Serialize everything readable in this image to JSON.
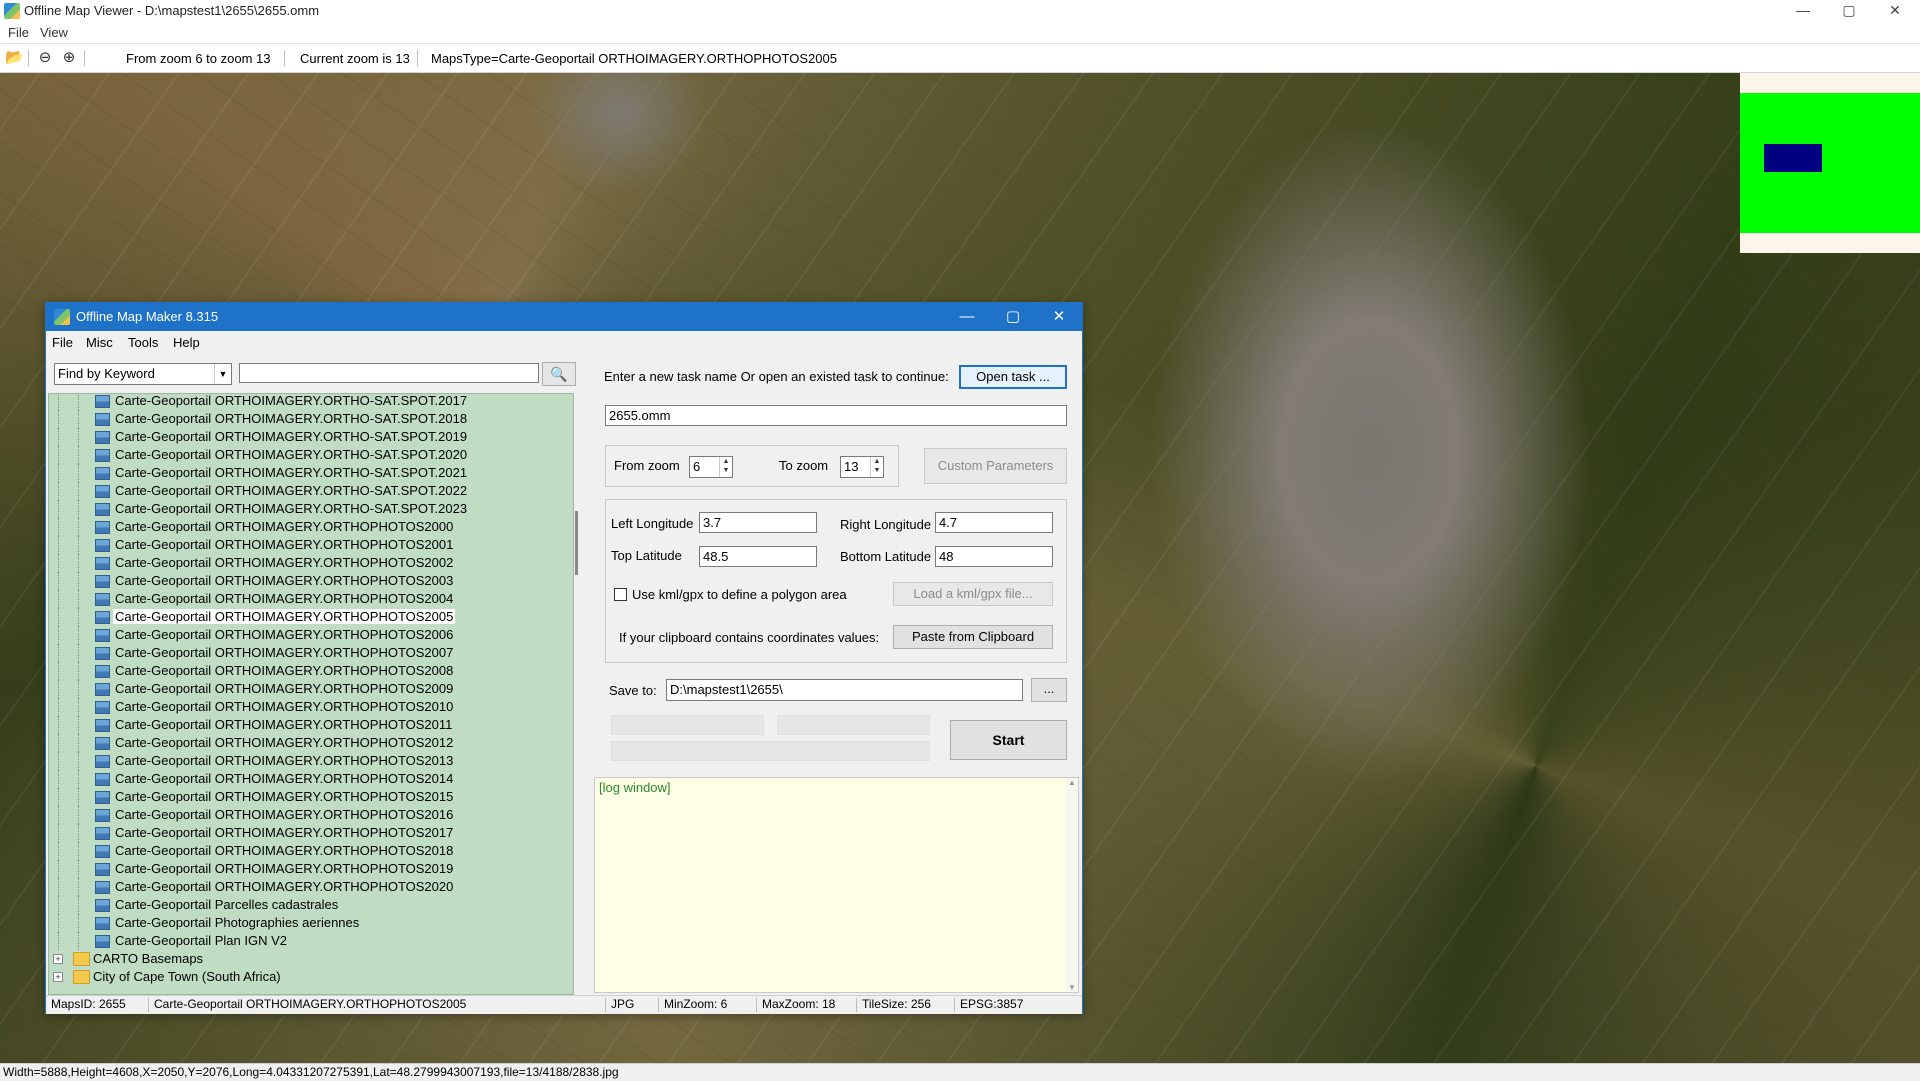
{
  "window": {
    "title": "Offline Map Viewer - D:\\mapstest1\\2655\\2655.omm",
    "menu": [
      "File",
      "View"
    ],
    "controls": [
      "—",
      "▢",
      "✕"
    ]
  },
  "toolbar": {
    "zoom_range": "From zoom 6 to zoom 13",
    "current_zoom": "Current zoom is 13",
    "maps_type": "MapsType=Carte-Geoportail ORTHOIMAGERY.ORTHOPHOTOS2005",
    "icons": [
      "open-folder-icon",
      "zoom-out-icon",
      "zoom-in-icon"
    ]
  },
  "statusbar": {
    "text": "Width=5888,Height=4608,X=2050,Y=2076,Long=4.04331207275391,Lat=48.2799943007193,file=13/4188/2838.jpg"
  },
  "colors": {
    "accent": "#1e73c8",
    "tree_bg": "#c0ddc4",
    "log_bg": "#ffffe6",
    "minimap_green": "#00ff00",
    "minimap_box": "#000080"
  },
  "dialog": {
    "title": "Offline Map Maker 8.315",
    "menu": [
      "File",
      "Misc",
      "Tools",
      "Help"
    ],
    "find_mode": "Find by Keyword",
    "search_value": "",
    "tree": {
      "selected_index": 12,
      "items": [
        "Carte-Geoportail ORTHOIMAGERY.ORTHO-SAT.SPOT.2017",
        "Carte-Geoportail ORTHOIMAGERY.ORTHO-SAT.SPOT.2018",
        "Carte-Geoportail ORTHOIMAGERY.ORTHO-SAT.SPOT.2019",
        "Carte-Geoportail ORTHOIMAGERY.ORTHO-SAT.SPOT.2020",
        "Carte-Geoportail ORTHOIMAGERY.ORTHO-SAT.SPOT.2021",
        "Carte-Geoportail ORTHOIMAGERY.ORTHO-SAT.SPOT.2022",
        "Carte-Geoportail ORTHOIMAGERY.ORTHO-SAT.SPOT.2023",
        "Carte-Geoportail ORTHOIMAGERY.ORTHOPHOTOS2000",
        "Carte-Geoportail ORTHOIMAGERY.ORTHOPHOTOS2001",
        "Carte-Geoportail ORTHOIMAGERY.ORTHOPHOTOS2002",
        "Carte-Geoportail ORTHOIMAGERY.ORTHOPHOTOS2003",
        "Carte-Geoportail ORTHOIMAGERY.ORTHOPHOTOS2004",
        "Carte-Geoportail ORTHOIMAGERY.ORTHOPHOTOS2005",
        "Carte-Geoportail ORTHOIMAGERY.ORTHOPHOTOS2006",
        "Carte-Geoportail ORTHOIMAGERY.ORTHOPHOTOS2007",
        "Carte-Geoportail ORTHOIMAGERY.ORTHOPHOTOS2008",
        "Carte-Geoportail ORTHOIMAGERY.ORTHOPHOTOS2009",
        "Carte-Geoportail ORTHOIMAGERY.ORTHOPHOTOS2010",
        "Carte-Geoportail ORTHOIMAGERY.ORTHOPHOTOS2011",
        "Carte-Geoportail ORTHOIMAGERY.ORTHOPHOTOS2012",
        "Carte-Geoportail ORTHOIMAGERY.ORTHOPHOTOS2013",
        "Carte-Geoportail ORTHOIMAGERY.ORTHOPHOTOS2014",
        "Carte-Geoportail ORTHOIMAGERY.ORTHOPHOTOS2015",
        "Carte-Geoportail ORTHOIMAGERY.ORTHOPHOTOS2016",
        "Carte-Geoportail ORTHOIMAGERY.ORTHOPHOTOS2017",
        "Carte-Geoportail ORTHOIMAGERY.ORTHOPHOTOS2018",
        "Carte-Geoportail ORTHOIMAGERY.ORTHOPHOTOS2019",
        "Carte-Geoportail ORTHOIMAGERY.ORTHOPHOTOS2020",
        "Carte-Geoportail Parcelles cadastrales",
        "Carte-Geoportail Photographies aeriennes",
        "Carte-Geoportail Plan IGN V2"
      ],
      "folders": [
        "CARTO Basemaps",
        "City of Cape Town (South Africa)"
      ]
    },
    "task_prompt": "Enter a new task name Or open an existed task to continue:",
    "open_task_label": "Open task ...",
    "task_name": "2655.omm",
    "from_zoom_label": "From zoom",
    "from_zoom": "6",
    "to_zoom_label": "To zoom",
    "to_zoom": "13",
    "custom_params_label": "Custom Parameters",
    "left_lon_label": "Left Longitude",
    "left_lon": "3.7",
    "right_lon_label": "Right Longitude",
    "right_lon": "4.7",
    "top_lat_label": "Top Latitude",
    "top_lat": "48.5",
    "bottom_lat_label": "Bottom Latitude",
    "bottom_lat": "48",
    "kml_label": "Use kml/gpx to define a polygon area",
    "load_kml_label": "Load a kml/gpx file...",
    "clipboard_prompt": "If your clipboard contains coordinates values:",
    "paste_label": "Paste from Clipboard",
    "save_to_label": "Save to:",
    "save_path": "D:\\mapstest1\\2655\\",
    "browse_label": "...",
    "start_label": "Start",
    "log_text": "[log window]",
    "status": {
      "maps_id": "MapsID: 2655",
      "map_name": "Carte-Geoportail ORTHOIMAGERY.ORTHOPHOTOS2005",
      "format": "JPG",
      "min_zoom": "MinZoom: 6",
      "max_zoom": "MaxZoom: 18",
      "tile_size": "TileSize: 256",
      "epsg": "EPSG:3857"
    }
  }
}
